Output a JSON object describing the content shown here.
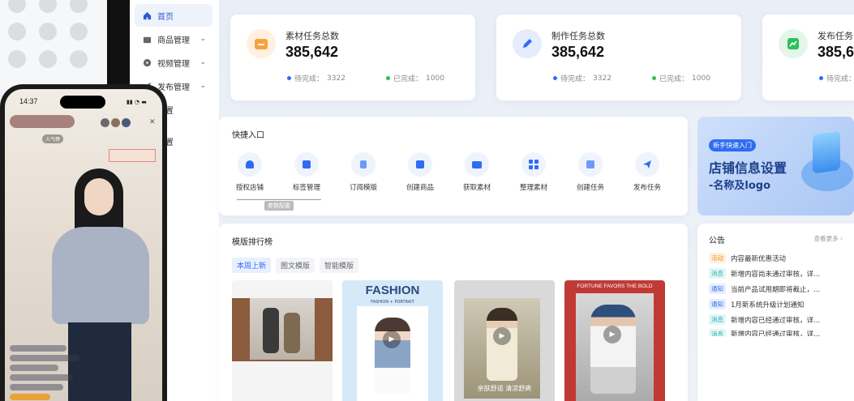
{
  "phone": {
    "time": "14:37",
    "top_badge": "人气榜"
  },
  "sidebar": {
    "items": [
      {
        "label": "首页",
        "icon": "home-icon"
      },
      {
        "label": "商品管理",
        "icon": "shop-icon"
      },
      {
        "label": "视频管理",
        "icon": "play-icon"
      },
      {
        "label": "发布管理",
        "icon": "send-icon"
      },
      {
        "label": "设置",
        "icon": "gear-icon"
      },
      {
        "label": "配置",
        "icon": "config-icon"
      }
    ]
  },
  "stats": [
    {
      "title": "素材任务总数",
      "value": "385,642",
      "pending_label": "待完成：",
      "pending": "3322",
      "done_label": "已完成：",
      "done": "1000"
    },
    {
      "title": "制作任务总数",
      "value": "385,642",
      "pending_label": "待完成：",
      "pending": "3322",
      "done_label": "已完成：",
      "done": "1000"
    },
    {
      "title": "发布任务",
      "value": "385,6",
      "pending_label": "待完成：",
      "pending": "",
      "done_label": "",
      "done": ""
    }
  ],
  "quick": {
    "title": "快捷入口",
    "items": [
      "授权店铺",
      "标签管理",
      "订阅模版",
      "创建商品",
      "获取素材",
      "整理素材",
      "创建任务",
      "发布任务"
    ],
    "tooltip": "参数配置"
  },
  "ranking": {
    "title": "模版排行榜",
    "tabs": [
      "本周上新",
      "图文模版",
      "智能模版"
    ],
    "fashion_text": "FASHION",
    "fashion_sub": "FASHION + PORTRAIT",
    "tpl3_text": "亲肤舒适 清凉舒爽",
    "tpl4_text": "FORTUNE FAVORS THE BOLD"
  },
  "banner": {
    "tag": "新手快速入门",
    "title": "店铺信息设置",
    "subtitle": "-名称及logo"
  },
  "notice": {
    "title": "公告",
    "more": "查看更多 ›",
    "items": [
      {
        "tag": "活动",
        "text": "内容最新优惠活动"
      },
      {
        "tag": "消息",
        "text": "新增内容尚未通过审核，详..."
      },
      {
        "tag": "通知",
        "text": "当前产品试用期即将截止，..."
      },
      {
        "tag": "通知",
        "text": "1月新系统升级计划通知"
      },
      {
        "tag": "消息",
        "text": "新增内容已经通过审核，详..."
      },
      {
        "tag": "消息",
        "text": "新增内容已经通过审核，详..."
      }
    ]
  },
  "colors": {
    "accent": "#2f6cf3",
    "pending_dot": "#2f6cf3",
    "done_dot": "#2fbf5a"
  }
}
